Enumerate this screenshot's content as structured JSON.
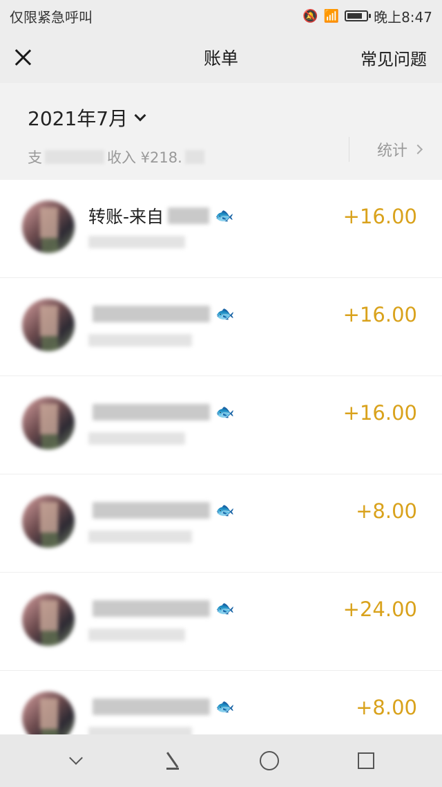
{
  "status_bar": {
    "carrier": "仅限紧急呼叫",
    "time": "晚上8:47",
    "icons": [
      "mute-icon",
      "wifi-icon",
      "signal-icon",
      "battery-icon"
    ],
    "battery_level": 0.8
  },
  "nav": {
    "title": "账单",
    "faq_label": "常见问题"
  },
  "summary": {
    "month": "2021年7月",
    "expense_label": "支",
    "income_label": "收入 ¥218.",
    "stats_label": "统计"
  },
  "transactions": [
    {
      "title": "转账-来自",
      "amount": "+16.00"
    },
    {
      "title": "",
      "amount": "+16.00"
    },
    {
      "title": "",
      "amount": "+16.00"
    },
    {
      "title": "",
      "amount": "+8.00"
    },
    {
      "title": "",
      "amount": "+24.00"
    },
    {
      "title": "",
      "amount": "+8.00"
    }
  ],
  "colors": {
    "amount": "#d9a21c",
    "background": "#ededed",
    "list_background": "#ffffff"
  }
}
